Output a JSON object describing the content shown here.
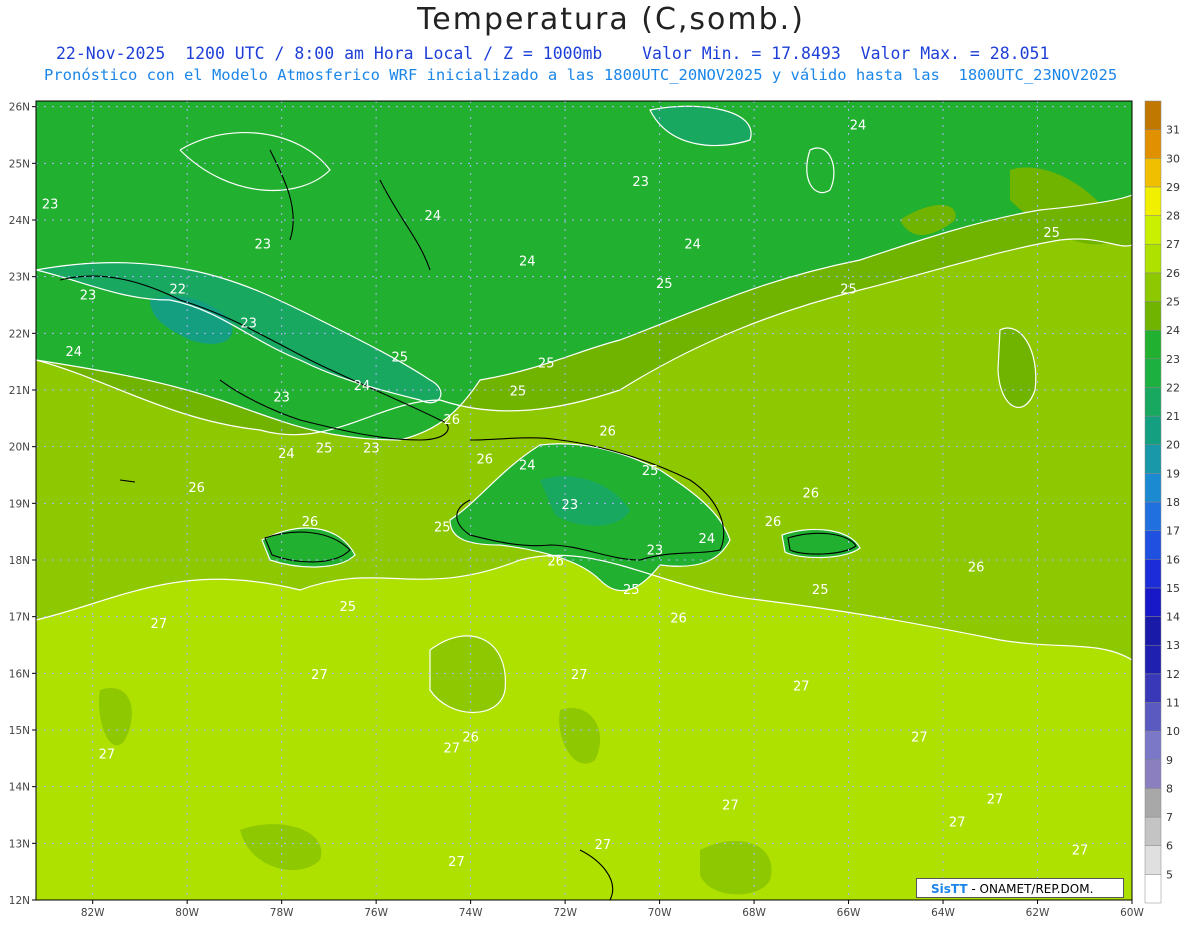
{
  "title": "Temperatura (C,somb.)",
  "subtitle_line1": "22-Nov-2025  1200 UTC / 8:00 am Hora Local / Z = 1000mb    Valor Min. = 17.8493  Valor Max. = 28.051",
  "subtitle_line2": "Pronóstico con el Modelo Atmosferico WRF inicializado a las 1800UTC_20NOV2025 y válido hasta las  1800UTC_23NOV2025",
  "credit": {
    "brand": "SisTT",
    "text": " - ONAMET/REP.DOM."
  },
  "map": {
    "lat_labels": [
      "26N",
      "25N",
      "24N",
      "23N",
      "22N",
      "21N",
      "20N",
      "19N",
      "18N",
      "17N",
      "16N",
      "15N",
      "14N",
      "13N",
      "12N"
    ],
    "lon_labels": [
      "82W",
      "80W",
      "78W",
      "76W",
      "74W",
      "72W",
      "70W",
      "68W",
      "66W",
      "64W",
      "62W",
      "60W"
    ],
    "lon_range": [
      -83.2,
      -60
    ],
    "lat_range": [
      12,
      26.1
    ],
    "colorbar": {
      "labels": [
        5,
        6,
        7,
        8,
        9,
        10,
        11,
        12,
        13,
        14,
        15,
        16,
        17,
        18,
        19,
        20,
        21,
        22,
        23,
        24,
        25,
        26,
        27,
        28,
        29,
        30,
        31
      ],
      "colors": [
        "#ffffff",
        "#e0e0e0",
        "#c4c4c4",
        "#a8a8a8",
        "#8c7fc0",
        "#7b78c8",
        "#5a5ac0",
        "#3838b8",
        "#2020b0",
        "#1a1aa8",
        "#1818c8",
        "#1c2cd8",
        "#2050e0",
        "#2070e0",
        "#1c8ad0",
        "#1898a8",
        "#14a080",
        "#18a860",
        "#1cb040",
        "#22b030",
        "#70b400",
        "#8ec800",
        "#aee000",
        "#c8f000",
        "#f0f000",
        "#f0c000",
        "#e09000",
        "#c07800"
      ]
    },
    "contour_labels": [
      {
        "text": "24",
        "lon": -65.8,
        "lat": 25.6
      },
      {
        "text": "23",
        "lon": -70.4,
        "lat": 24.6
      },
      {
        "text": "23",
        "lon": -82.9,
        "lat": 24.2
      },
      {
        "text": "24",
        "lon": -74.8,
        "lat": 24.0
      },
      {
        "text": "23",
        "lon": -78.4,
        "lat": 23.5
      },
      {
        "text": "24",
        "lon": -69.3,
        "lat": 23.5
      },
      {
        "text": "24",
        "lon": -72.8,
        "lat": 23.2
      },
      {
        "text": "25",
        "lon": -61.7,
        "lat": 23.7
      },
      {
        "text": "23",
        "lon": -82.1,
        "lat": 22.6
      },
      {
        "text": "22",
        "lon": -80.2,
        "lat": 22.7
      },
      {
        "text": "23",
        "lon": -78.7,
        "lat": 22.1
      },
      {
        "text": "25",
        "lon": -69.9,
        "lat": 22.8
      },
      {
        "text": "25",
        "lon": -66.0,
        "lat": 22.7
      },
      {
        "text": "24",
        "lon": -82.4,
        "lat": 21.6
      },
      {
        "text": "25",
        "lon": -75.5,
        "lat": 21.5
      },
      {
        "text": "25",
        "lon": -72.4,
        "lat": 21.4
      },
      {
        "text": "24",
        "lon": -76.3,
        "lat": 21.0
      },
      {
        "text": "23",
        "lon": -78.0,
        "lat": 20.8
      },
      {
        "text": "25",
        "lon": -73.0,
        "lat": 20.9
      },
      {
        "text": "26",
        "lon": -74.4,
        "lat": 20.4
      },
      {
        "text": "26",
        "lon": -71.1,
        "lat": 20.2
      },
      {
        "text": "24",
        "lon": -77.9,
        "lat": 19.8
      },
      {
        "text": "25",
        "lon": -77.1,
        "lat": 19.9
      },
      {
        "text": "23",
        "lon": -76.1,
        "lat": 19.9
      },
      {
        "text": "26",
        "lon": -73.7,
        "lat": 19.7
      },
      {
        "text": "24",
        "lon": -72.8,
        "lat": 19.6
      },
      {
        "text": "25",
        "lon": -70.2,
        "lat": 19.5
      },
      {
        "text": "26",
        "lon": -79.8,
        "lat": 19.2
      },
      {
        "text": "23",
        "lon": -71.9,
        "lat": 18.9
      },
      {
        "text": "26",
        "lon": -66.8,
        "lat": 19.1
      },
      {
        "text": "26",
        "lon": -77.4,
        "lat": 18.6
      },
      {
        "text": "25",
        "lon": -74.6,
        "lat": 18.5
      },
      {
        "text": "26",
        "lon": -67.6,
        "lat": 18.6
      },
      {
        "text": "24",
        "lon": -69.0,
        "lat": 18.3
      },
      {
        "text": "23",
        "lon": -70.1,
        "lat": 18.1
      },
      {
        "text": "26",
        "lon": -72.2,
        "lat": 17.9
      },
      {
        "text": "26",
        "lon": -63.3,
        "lat": 17.8
      },
      {
        "text": "25",
        "lon": -70.6,
        "lat": 17.4
      },
      {
        "text": "25",
        "lon": -66.6,
        "lat": 17.4
      },
      {
        "text": "25",
        "lon": -76.6,
        "lat": 17.1
      },
      {
        "text": "26",
        "lon": -69.6,
        "lat": 16.9
      },
      {
        "text": "27",
        "lon": -80.6,
        "lat": 16.8
      },
      {
        "text": "27",
        "lon": -77.2,
        "lat": 15.9
      },
      {
        "text": "27",
        "lon": -71.7,
        "lat": 15.9
      },
      {
        "text": "27",
        "lon": -67.0,
        "lat": 15.7
      },
      {
        "text": "26",
        "lon": -74.0,
        "lat": 14.8
      },
      {
        "text": "27",
        "lon": -81.7,
        "lat": 14.5
      },
      {
        "text": "27",
        "lon": -74.4,
        "lat": 14.6
      },
      {
        "text": "27",
        "lon": -64.5,
        "lat": 14.8
      },
      {
        "text": "27",
        "lon": -68.5,
        "lat": 13.6
      },
      {
        "text": "27",
        "lon": -62.9,
        "lat": 13.7
      },
      {
        "text": "27",
        "lon": -63.7,
        "lat": 13.3
      },
      {
        "text": "27",
        "lon": -71.2,
        "lat": 12.9
      },
      {
        "text": "27",
        "lon": -74.3,
        "lat": 12.6
      },
      {
        "text": "27",
        "lon": -61.1,
        "lat": 12.8
      }
    ]
  }
}
